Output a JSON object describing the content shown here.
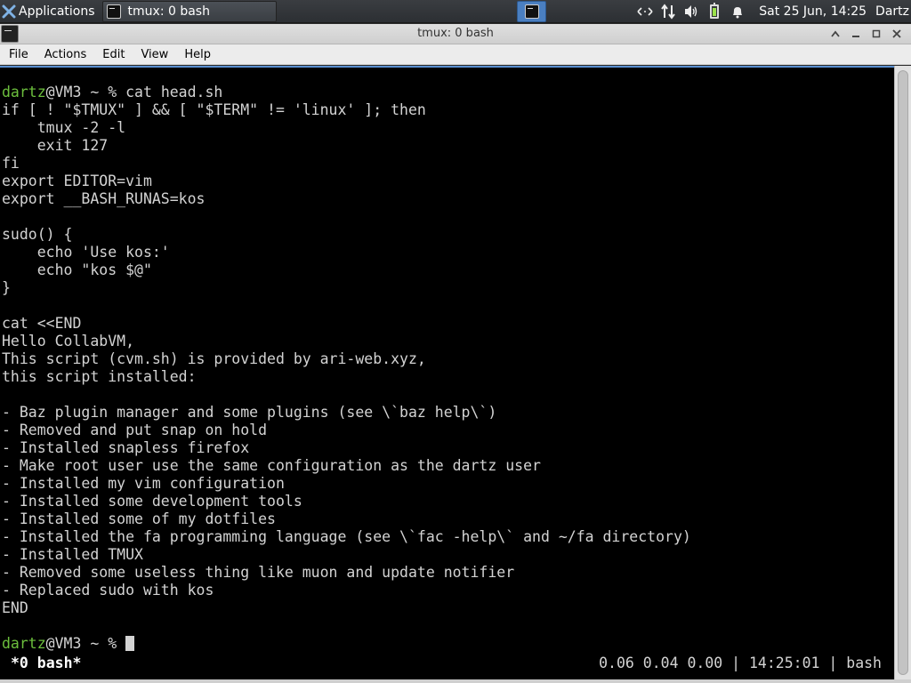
{
  "panel": {
    "apps_label": "Applications",
    "task_label": "tmux: 0 bash",
    "clock": "Sat 25 Jun, 14:25",
    "user": "Dartz",
    "tray_icons": [
      "network-arrows-icon",
      "transfer-icon",
      "volume-icon",
      "battery-icon",
      "notification-bell-icon"
    ]
  },
  "window": {
    "title": "tmux: 0 bash"
  },
  "menu": [
    "File",
    "Actions",
    "Edit",
    "View",
    "Help"
  ],
  "terminal": {
    "prompt_user": "dartz",
    "prompt_rest": "@VM3 ~ % ",
    "command": "cat head.sh",
    "output": [
      "if [ ! \"$TMUX\" ] && [ \"$TERM\" != 'linux' ]; then",
      "    tmux -2 -l",
      "    exit 127",
      "fi",
      "export EDITOR=vim",
      "export __BASH_RUNAS=kos",
      "",
      "sudo() {",
      "    echo 'Use kos:'",
      "    echo \"kos $@\"",
      "}",
      "",
      "cat <<END",
      "Hello CollabVM,",
      "This script (cvm.sh) is provided by ari-web.xyz,",
      "this script installed:",
      "",
      "- Baz plugin manager and some plugins (see \\`baz help\\`)",
      "- Removed and put snap on hold",
      "- Installed snapless firefox",
      "- Make root user use the same configuration as the dartz user",
      "- Installed my vim configuration",
      "- Installed some development tools",
      "- Installed some of my dotfiles",
      "- Installed the fa programming language (see \\`fac -help\\` and ~/fa directory)",
      "- Installed TMUX",
      "- Removed some useless thing like muon and update notifier",
      "- Replaced sudo with kos",
      "END",
      ""
    ],
    "status_left": "*0 bash*",
    "status_right": "0.06 0.04 0.00 | 14:25:01 | bash"
  },
  "colors": {
    "prompt_green": "#6cbf3d",
    "terminal_bg": "#000000",
    "terminal_fg": "#d3d3d3",
    "accent": "#4a7fc1"
  }
}
